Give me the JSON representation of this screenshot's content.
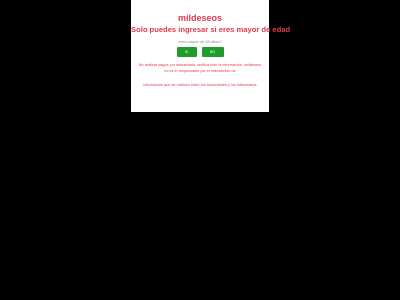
{
  "modal": {
    "brand": "mildeseos",
    "headline": "Solo puedes ingresar si eres mayor de edad",
    "question": "eres mayor de 18 años?",
    "yes_label": "SI",
    "no_label": "NO",
    "notice": "No realizar pagos por adelantado, verifica bien la información, mildeseos no es el responsable por el intercambio de",
    "notice2": "información que se realicen entre los anunciantes y los interesados"
  },
  "colors": {
    "page_background": "#000000",
    "modal_background": "#ffffff",
    "brand_red": "#e03a4b",
    "button_green": "#1f9c2a"
  }
}
